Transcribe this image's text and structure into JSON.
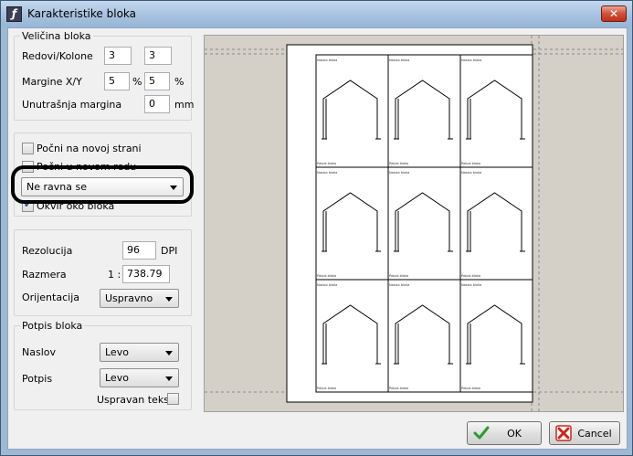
{
  "window": {
    "title": "Karakteristike bloka",
    "close_symbol": "✕"
  },
  "size_group": {
    "legend": "Veličina bloka",
    "rows_cols_label": "Redovi/Kolone",
    "rows_value": "3",
    "cols_value": "3",
    "margins_label": "Margine X/Y",
    "margin_x_value": "5",
    "margin_y_value": "5",
    "percent_unit": "%",
    "inner_margin_label": "Unutrašnja margina",
    "inner_margin_value": "0",
    "mm_unit": "mm"
  },
  "page_group": {
    "new_page_label": "Počni na novoj strani",
    "new_page_checked": false,
    "new_row_label": "Počni u novom redu",
    "new_row_checked": false,
    "align_select_value": "Ne ravna se",
    "frame_label": "Okvir oko bloka",
    "frame_checked": true
  },
  "render_group": {
    "resolution_label": "Rezolucija",
    "resolution_value": "96",
    "dpi_unit": "DPI",
    "scale_label": "Razmera",
    "scale_prefix": "1 :",
    "scale_value": "738.79",
    "orientation_label": "Orijentacija",
    "orientation_value": "Uspravno"
  },
  "caption_group": {
    "legend": "Potpis bloka",
    "title_label": "Naslov",
    "title_value": "Levo",
    "caption_label": "Potpis",
    "caption_value": "Levo",
    "vertical_text_label": "Uspravan tekst",
    "vertical_text_checked": false
  },
  "preview": {
    "rows": 3,
    "cols": 3,
    "cell_caption": "Potpis bloka",
    "cell_title": "Naslov bloka"
  },
  "buttons": {
    "ok_label": "OK",
    "cancel_label": "Cancel"
  },
  "colors": {
    "ok_icon": "#2e9a2e",
    "cancel_icon": "#c8281e",
    "highlight": "#000000"
  }
}
